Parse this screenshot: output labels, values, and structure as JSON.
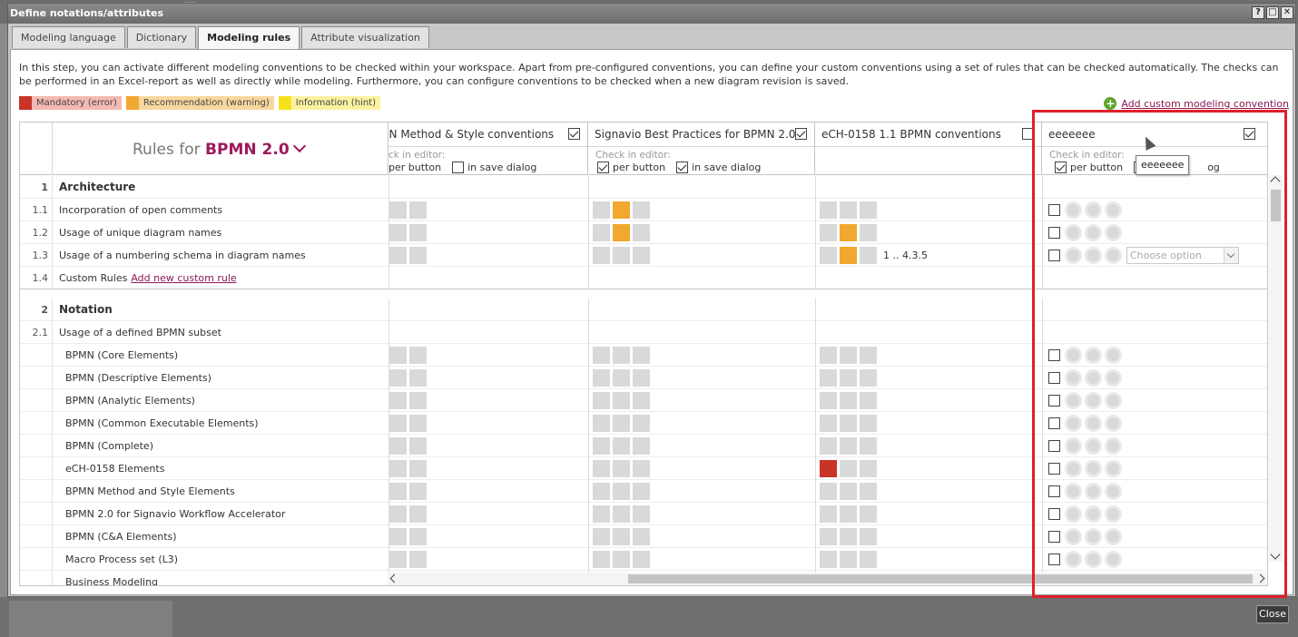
{
  "window": {
    "title": "Define notations/attributes",
    "bg_item": "case"
  },
  "title_buttons": [
    "?",
    "□",
    "✕"
  ],
  "tabs": [
    {
      "label": "Modeling language",
      "active": false
    },
    {
      "label": "Dictionary",
      "active": false
    },
    {
      "label": "Modeling rules",
      "active": true
    },
    {
      "label": "Attribute visualization",
      "active": false
    }
  ],
  "intro": "In this step, you can activate different modeling conventions to be checked within your workspace. Apart from pre-configured conventions, you can define your custom conventions using a set of rules that can be checked automatically. The checks can be performed in an Excel-report as well as directly while modeling. Furthermore, you can configure conventions to be checked when a new diagram revision is saved.",
  "legend": [
    {
      "label": "Mandatory (error)",
      "color": "#c83427",
      "bg": "#f4b9b4"
    },
    {
      "label": "Recommendation (warning)",
      "color": "#f0a830",
      "bg": "#f8d79e"
    },
    {
      "label": "Information (hint)",
      "color": "#f6e21c",
      "bg": "#fbf2a0"
    }
  ],
  "add_convention_label": "Add custom modeling convention",
  "rules_header": {
    "prefix": "Rules for",
    "notation": "BPMN 2.0"
  },
  "check_in_editor": "Check in editor:",
  "per_button": "per button",
  "in_save_dialog": "in save dialog",
  "conventions": [
    {
      "name": "BPMN Method & Style conventions",
      "shown": "IN Method & Style conventions",
      "checked": true,
      "per_button": true,
      "in_save_dialog": false,
      "editor_label": "ck in editor:"
    },
    {
      "name": "Signavio Best Practices for BPMN 2.0",
      "shown": "Signavio Best Practices for BPMN 2.0",
      "checked": true,
      "per_button": true,
      "in_save_dialog": true,
      "editor_label": "Check in editor:"
    },
    {
      "name": "eCH-0158 1.1 BPMN conventions",
      "shown": "eCH-0158 1.1 BPMN conventions",
      "checked": false
    },
    {
      "name": "eeeeeee",
      "shown": "eeeeeee",
      "checked": true,
      "per_button": true,
      "in_save_dialog": false,
      "editor_label": "Check in editor:",
      "save_dialog_partial": "og"
    }
  ],
  "tooltip": "eeeeeee",
  "choose_option": "Choose option",
  "numbering_value": "1 .. 4.3.5",
  "custom_rules": {
    "label": "Custom Rules",
    "link": "Add new custom rule"
  },
  "rows": [
    {
      "num": "1",
      "label": "Architecture",
      "type": "section"
    },
    {
      "num": "1.1",
      "label": "Incorporation of open comments",
      "c1": [
        0,
        0
      ],
      "c2": [
        0,
        2,
        0
      ],
      "c3": [
        0,
        0,
        0
      ]
    },
    {
      "num": "1.2",
      "label": "Usage of unique diagram names",
      "c1": [
        0,
        0
      ],
      "c2": [
        0,
        2,
        0
      ],
      "c3": [
        0,
        2,
        0
      ]
    },
    {
      "num": "1.3",
      "label": "Usage of a numbering schema in diagram names",
      "c1": [
        0,
        0
      ],
      "c2": [
        0,
        0,
        0
      ],
      "c3": [
        0,
        2,
        0
      ]
    },
    {
      "num": "1.4",
      "label": "Custom Rules",
      "type": "custom"
    },
    {
      "num": "2",
      "label": "Notation",
      "type": "section"
    },
    {
      "num": "2.1",
      "label": "Usage of a defined BPMN subset",
      "type": "plain"
    },
    {
      "num": "",
      "label": "BPMN (Core Elements)",
      "c1": [
        0,
        0
      ],
      "c2": [
        0,
        0,
        0
      ],
      "c3": [
        0,
        0,
        0
      ]
    },
    {
      "num": "",
      "label": "BPMN (Descriptive Elements)",
      "c1": [
        0,
        0
      ],
      "c2": [
        0,
        0,
        0
      ],
      "c3": [
        0,
        0,
        0
      ]
    },
    {
      "num": "",
      "label": "BPMN (Analytic Elements)",
      "c1": [
        0,
        0
      ],
      "c2": [
        0,
        0,
        0
      ],
      "c3": [
        0,
        0,
        0
      ]
    },
    {
      "num": "",
      "label": "BPMN (Common Executable Elements)",
      "c1": [
        0,
        0
      ],
      "c2": [
        0,
        0,
        0
      ],
      "c3": [
        0,
        0,
        0
      ]
    },
    {
      "num": "",
      "label": "BPMN (Complete)",
      "c1": [
        0,
        0
      ],
      "c2": [
        0,
        0,
        0
      ],
      "c3": [
        0,
        0,
        0
      ]
    },
    {
      "num": "",
      "label": "eCH-0158 Elements",
      "c1": [
        0,
        0
      ],
      "c2": [
        0,
        0,
        0
      ],
      "c3": [
        1,
        0,
        0
      ]
    },
    {
      "num": "",
      "label": "BPMN Method and Style Elements",
      "c1": [
        0,
        0
      ],
      "c2": [
        0,
        0,
        0
      ],
      "c3": [
        0,
        0,
        0
      ]
    },
    {
      "num": "",
      "label": "BPMN 2.0 for Signavio Workflow Accelerator",
      "c1": [
        0,
        0
      ],
      "c2": [
        0,
        0,
        0
      ],
      "c3": [
        0,
        0,
        0
      ]
    },
    {
      "num": "",
      "label": "BPMN (C&A Elements)",
      "c1": [
        0,
        0
      ],
      "c2": [
        0,
        0,
        0
      ],
      "c3": [
        0,
        0,
        0
      ]
    },
    {
      "num": "",
      "label": "Macro Process set (L3)",
      "c1": [
        0,
        0
      ],
      "c2": [
        0,
        0,
        0
      ],
      "c3": [
        0,
        0,
        0
      ]
    },
    {
      "num": "",
      "label": "Business Modeling",
      "c1": [
        0,
        0
      ],
      "c2": [
        0,
        0,
        0
      ],
      "c3": [
        0,
        0,
        0
      ]
    }
  ],
  "close_label": "Close"
}
